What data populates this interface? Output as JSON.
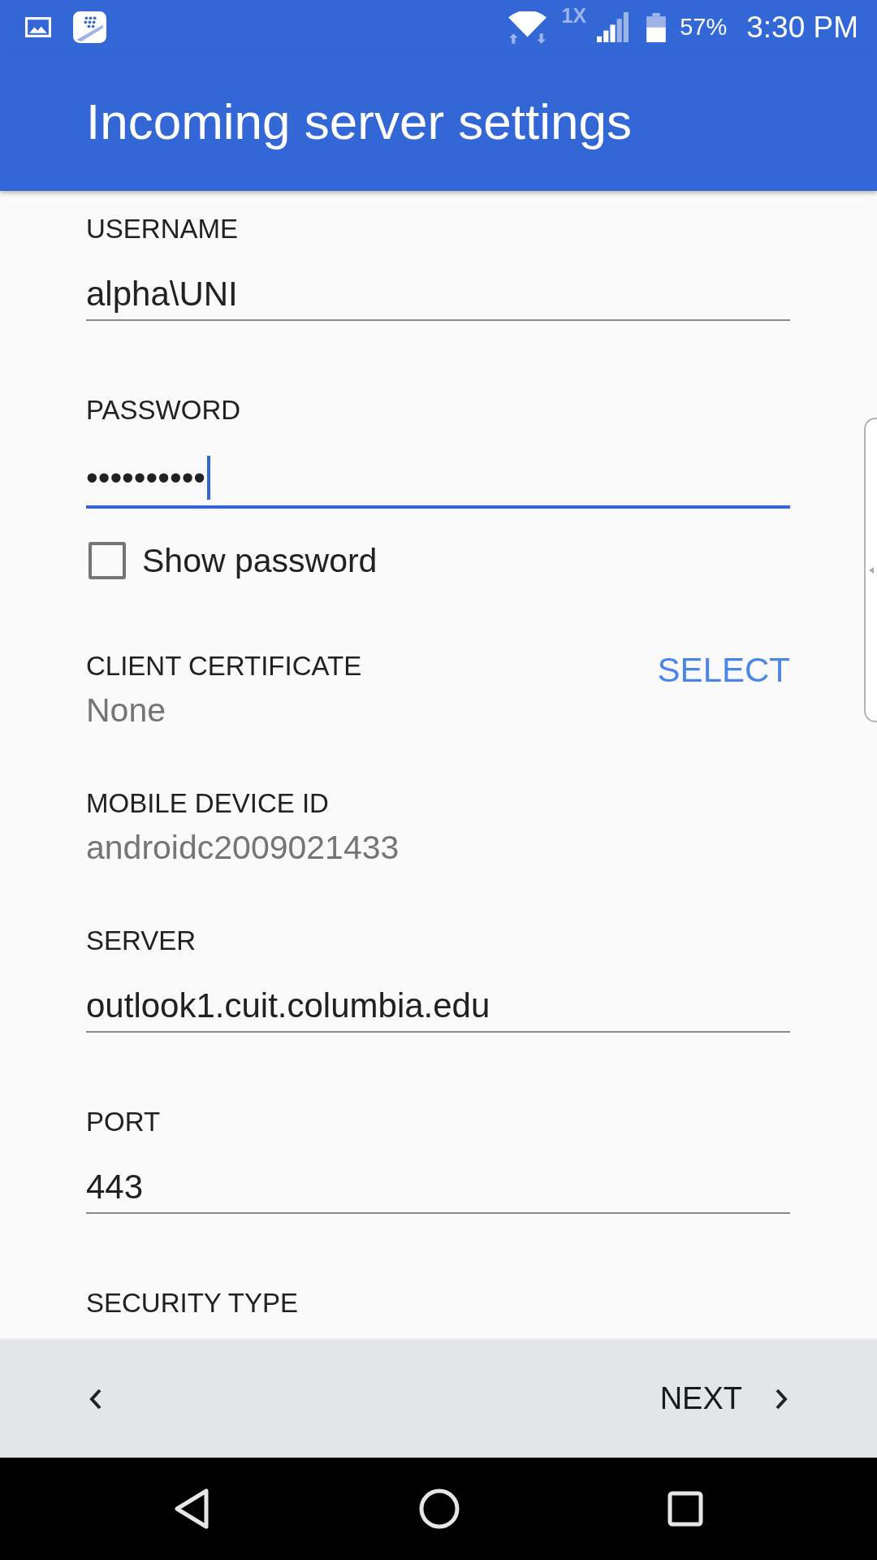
{
  "status_bar": {
    "network_type": "1X",
    "battery": "57%",
    "time": "3:30 PM"
  },
  "app_bar": {
    "title": "Incoming server settings"
  },
  "form": [
    {
      "kind": "text_field",
      "label": "USERNAME",
      "value": "alpha\\UNI",
      "focused": false
    },
    {
      "kind": "text_field",
      "label": "PASSWORD",
      "value": "••••••••••",
      "focused": true
    },
    {
      "kind": "checkbox",
      "label": "Show password",
      "checked": false
    },
    {
      "kind": "chooser",
      "label": "CLIENT CERTIFICATE",
      "value": "None",
      "action": "SELECT"
    },
    {
      "kind": "info",
      "label": "MOBILE DEVICE ID",
      "value": "androidc2009021433"
    },
    {
      "kind": "text_field",
      "label": "SERVER",
      "value": "outlook1.cuit.columbia.edu",
      "focused": false
    },
    {
      "kind": "text_field",
      "label": "PORT",
      "value": "443",
      "focused": false
    },
    {
      "kind": "label",
      "label": "SECURITY TYPE"
    }
  ],
  "footer": {
    "next": "NEXT"
  }
}
